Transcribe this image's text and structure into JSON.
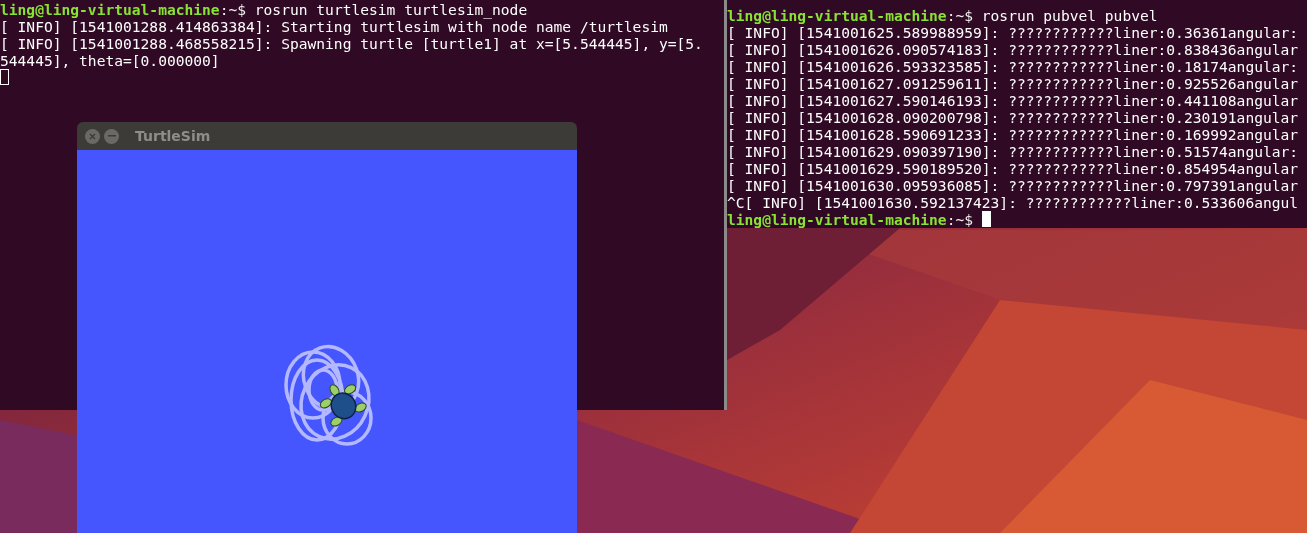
{
  "left_terminal": {
    "focused": false,
    "lines": [
      {
        "kind": "prompt",
        "user": "ling@ling-virtual-machine",
        "path": ":~$",
        "command": "rosrun turtlesim turtlesim_node"
      },
      {
        "kind": "output",
        "text": "[ INFO] [1541001288.414863384]: Starting turtlesim with node name /turtlesim"
      },
      {
        "kind": "output",
        "text": "[ INFO] [1541001288.468558215]: Spawning turtle [turtle1] at x=[5.544445], y=[5."
      },
      {
        "kind": "output",
        "text": "544445], theta=[0.000000]"
      },
      {
        "kind": "cursor"
      }
    ]
  },
  "turtlesim": {
    "title": "TurtleSim"
  },
  "right_terminal": {
    "focused": true,
    "lines": [
      {
        "kind": "prompt",
        "user": "ling@ling-virtual-machine",
        "path": ":~$",
        "command": "rosrun pubvel pubvel"
      },
      {
        "kind": "output",
        "text": "[ INFO] [1541001625.589988959]: ????????????liner:0.36361angular:"
      },
      {
        "kind": "output",
        "text": "[ INFO] [1541001626.090574183]: ????????????liner:0.838436angular"
      },
      {
        "kind": "output",
        "text": "[ INFO] [1541001626.593323585]: ????????????liner:0.18174angular:"
      },
      {
        "kind": "output",
        "text": "[ INFO] [1541001627.091259611]: ????????????liner:0.925526angular"
      },
      {
        "kind": "output",
        "text": "[ INFO] [1541001627.590146193]: ????????????liner:0.441108angular"
      },
      {
        "kind": "output",
        "text": "[ INFO] [1541001628.090200798]: ????????????liner:0.230191angular"
      },
      {
        "kind": "output",
        "text": "[ INFO] [1541001628.590691233]: ????????????liner:0.169992angular"
      },
      {
        "kind": "output",
        "text": "[ INFO] [1541001629.090397190]: ????????????liner:0.51574angular:"
      },
      {
        "kind": "output",
        "text": "[ INFO] [1541001629.590189520]: ????????????liner:0.854954angular"
      },
      {
        "kind": "output",
        "text": "[ INFO] [1541001630.095936085]: ????????????liner:0.797391angular"
      },
      {
        "kind": "output",
        "text": "^C[ INFO] [1541001630.592137423]: ????????????liner:0.533606angul"
      },
      {
        "kind": "prompt",
        "user": "ling@ling-virtual-machine",
        "path": ":~$",
        "cursor": true
      }
    ]
  }
}
